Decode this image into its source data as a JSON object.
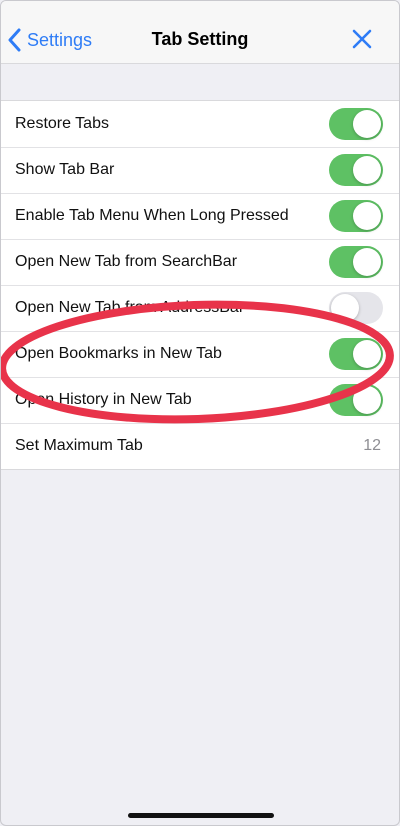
{
  "nav": {
    "back_label": "Settings",
    "title": "Tab Setting",
    "back_icon": "chevron-left-icon",
    "close_icon": "close-icon"
  },
  "settings": [
    {
      "label": "Restore Tabs",
      "control": "toggle",
      "on": true
    },
    {
      "label": "Show Tab Bar",
      "control": "toggle",
      "on": true
    },
    {
      "label": "Enable Tab Menu When Long Pressed",
      "control": "toggle",
      "on": true
    },
    {
      "label": "Open New Tab from SearchBar",
      "control": "toggle",
      "on": true
    },
    {
      "label": "Open New Tab from AddressBar",
      "control": "toggle",
      "on": false
    },
    {
      "label": "Open Bookmarks in New Tab",
      "control": "toggle",
      "on": true
    },
    {
      "label": "Open History in New Tab",
      "control": "toggle",
      "on": true
    },
    {
      "label": "Set Maximum Tab",
      "control": "value",
      "value": "12"
    }
  ],
  "colors": {
    "accent": "#2e7cf6",
    "toggle_on": "#5ec164",
    "toggle_off": "#e5e5ea",
    "annotation": "#e8334a"
  }
}
